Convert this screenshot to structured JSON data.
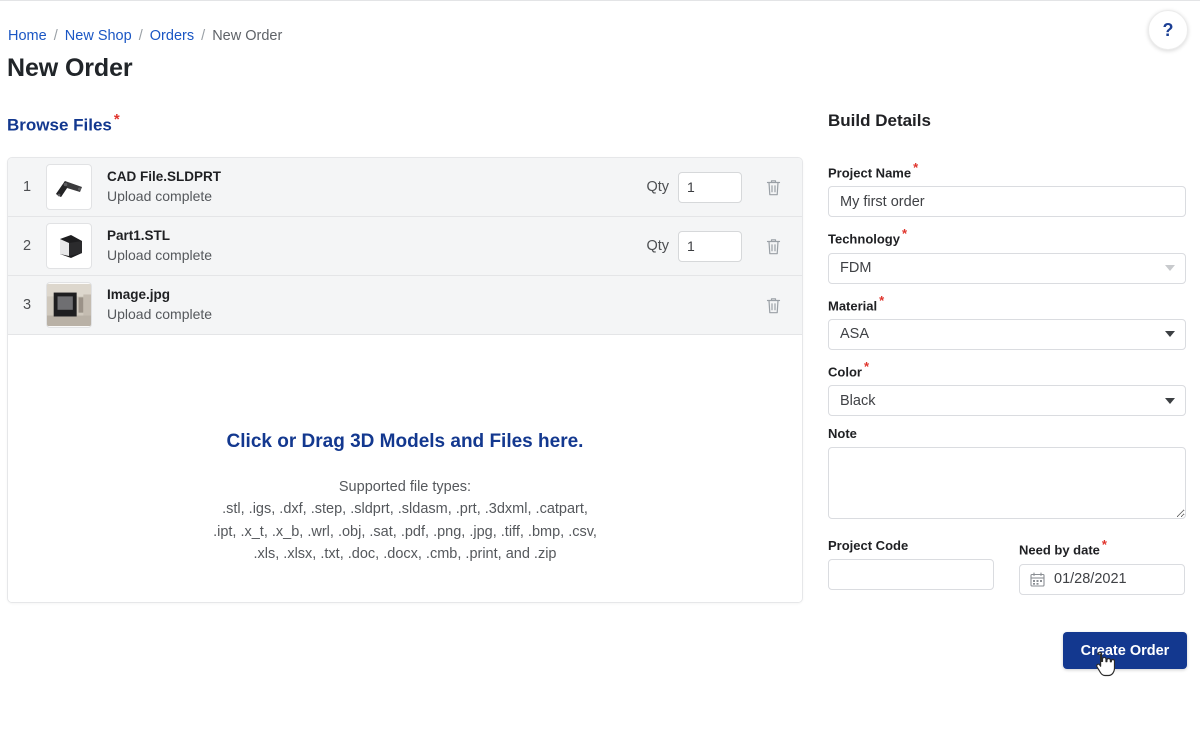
{
  "breadcrumb": {
    "items": [
      {
        "label": "Home",
        "type": "link"
      },
      {
        "label": "New Shop",
        "type": "link"
      },
      {
        "label": "Orders",
        "type": "link"
      },
      {
        "label": "New Order",
        "type": "current"
      }
    ],
    "separator": "/"
  },
  "page_title": "New Order",
  "help_button": {
    "label": "?",
    "icon": "question-mark-icon"
  },
  "browse": {
    "heading": "Browse Files",
    "required_marker": "*",
    "files": [
      {
        "index": "1",
        "name": "CAD File.SLDPRT",
        "status": "Upload complete",
        "qty_label": "Qty",
        "qty": "1",
        "has_qty": true,
        "thumbnail": "cad-bracket-thumbnail"
      },
      {
        "index": "2",
        "name": "Part1.STL",
        "status": "Upload complete",
        "qty_label": "Qty",
        "qty": "1",
        "has_qty": true,
        "thumbnail": "cube-model-thumbnail"
      },
      {
        "index": "3",
        "name": "Image.jpg",
        "status": "Upload complete",
        "qty_label": "",
        "qty": "",
        "has_qty": false,
        "thumbnail": "photo-thumbnail"
      }
    ],
    "dropzone": {
      "title": "Click or Drag 3D Models and Files here.",
      "subtitle_lines": [
        "Supported file types:",
        ".stl, .igs, .dxf, .step, .sldprt, .sldasm, .prt, .3dxml, .catpart,",
        ".ipt, .x_t, .x_b, .wrl, .obj, .sat, .pdf, .png, .jpg, .tiff, .bmp, .csv,",
        ".xls, .xlsx, .txt, .doc, .docx, .cmb, .print, and .zip"
      ]
    }
  },
  "build_details": {
    "heading": "Build Details",
    "project_name": {
      "label": "Project Name",
      "required": "*",
      "value": "My first order"
    },
    "technology": {
      "label": "Technology",
      "required": "*",
      "value": "FDM"
    },
    "material": {
      "label": "Material",
      "required": "*",
      "value": "ASA"
    },
    "color": {
      "label": "Color",
      "required": "*",
      "value": "Black"
    },
    "note": {
      "label": "Note",
      "value": ""
    },
    "project_code": {
      "label": "Project Code",
      "value": ""
    },
    "need_by_date": {
      "label": "Need by date",
      "required": "*",
      "value": "01/28/2021",
      "icon": "calendar-icon"
    },
    "submit_button": "Create Order"
  },
  "colors": {
    "brand_navy": "#13388f",
    "link_blue": "#1a56c4",
    "required_red": "#e0342c",
    "row_background": "#f4f5f6"
  }
}
